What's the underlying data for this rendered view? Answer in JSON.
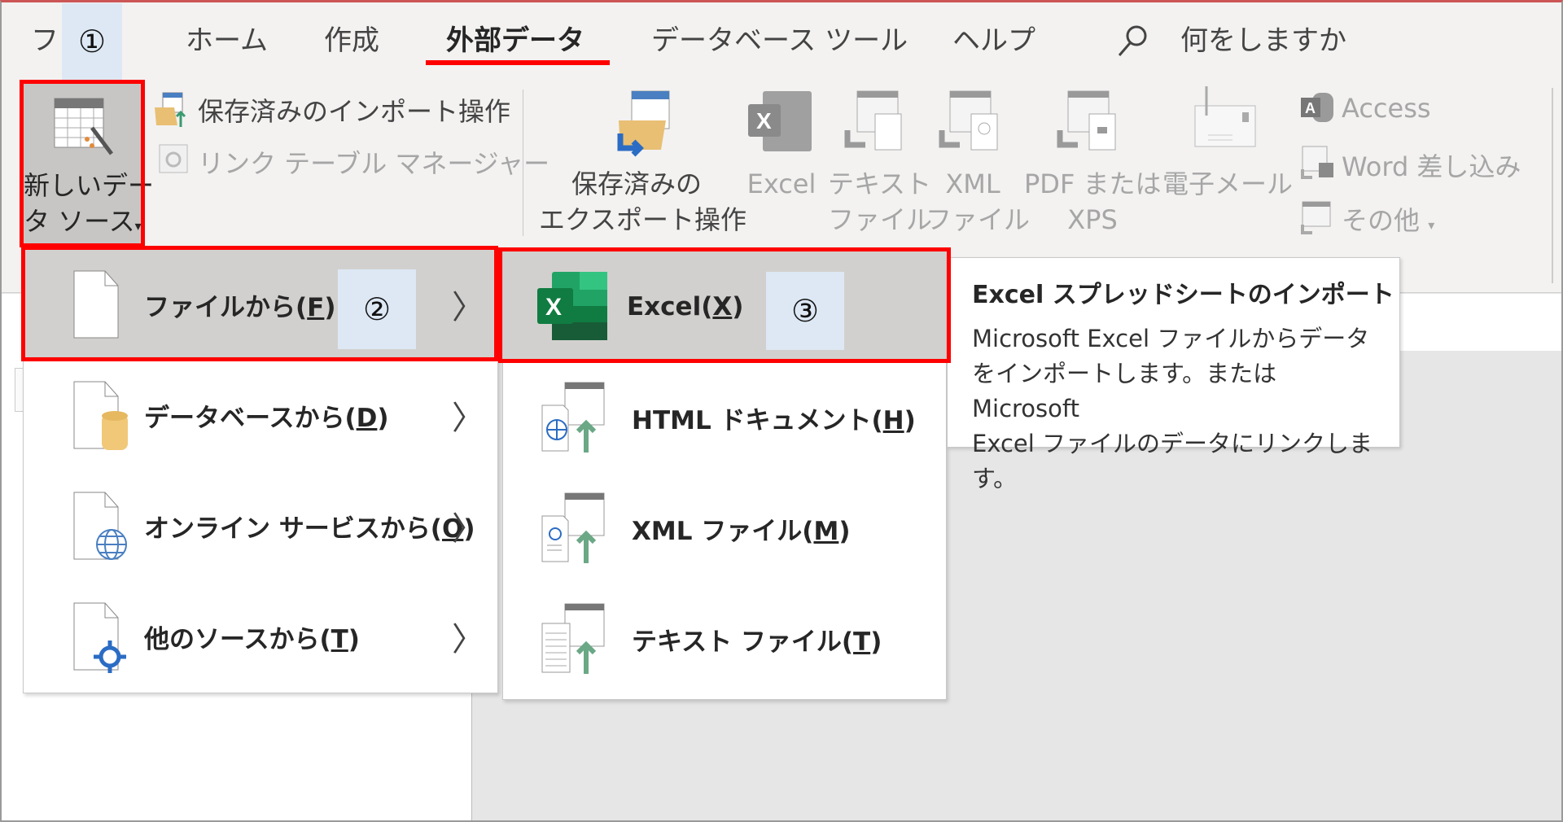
{
  "tabs": [
    {
      "label": "フ",
      "active": false
    },
    {
      "label": "ホーム",
      "active": false
    },
    {
      "label": "作成",
      "active": false
    },
    {
      "label": "外部データ",
      "active": true
    },
    {
      "label": "データベース ツール",
      "active": false
    },
    {
      "label": "ヘルプ",
      "active": false
    }
  ],
  "search": {
    "icon": "search-icon",
    "placeholder": "何をしますか"
  },
  "annotations": {
    "step1": "①",
    "step2": "②",
    "step3": "③",
    "highlight_color": "#ff0000"
  },
  "ribbon": {
    "new_source": {
      "line1": "新しいデー",
      "line2": "タ ソース",
      "caret": "▾"
    },
    "saved_imports": "保存済みのインポート操作",
    "linked_table_manager": "リンク テーブル マネージャー",
    "saved_exports": {
      "line1": "保存済みの",
      "line2": "エクスポート操作"
    },
    "export": [
      {
        "line1": "Excel",
        "line2": ""
      },
      {
        "line1": "テキスト",
        "line2": "ファイル"
      },
      {
        "line1": "XML",
        "line2": "ファイル"
      },
      {
        "line1": "PDF または",
        "line2": "XPS"
      },
      {
        "line1": "電子メール",
        "line2": ""
      }
    ],
    "access": "Access",
    "word_merge": "Word 差し込み",
    "more": "その他",
    "more_caret": "▾"
  },
  "menu1": {
    "items": [
      {
        "label": "ファイルから(",
        "key": "F",
        "end": ")",
        "icon": "file-icon",
        "chevron": "〉"
      },
      {
        "label": "データベースから(",
        "key": "D",
        "end": ")",
        "icon": "database-file-icon",
        "chevron": "〉"
      },
      {
        "label": "オンライン サービスから(",
        "key": "O",
        "end": ")",
        "icon": "online-service-icon",
        "chevron": "〉"
      },
      {
        "label": "他のソースから(",
        "key": "T",
        "end": ")",
        "icon": "other-source-icon",
        "chevron": "〉"
      }
    ]
  },
  "menu2": {
    "items": [
      {
        "label": "Excel(",
        "key": "X",
        "end": ")",
        "icon": "excel-icon"
      },
      {
        "label": "HTML ドキュメント(",
        "key": "H",
        "end": ")",
        "icon": "html-import-icon"
      },
      {
        "label": "XML ファイル(",
        "key": "M",
        "end": ")",
        "icon": "xml-import-icon"
      },
      {
        "label": "テキスト ファイル(",
        "key": "T",
        "end": ")",
        "icon": "text-import-icon"
      }
    ]
  },
  "tooltip": {
    "title": "Excel スプレッドシートのインポート",
    "body_line1": "Microsoft Excel ファイルからデータ",
    "body_line2": "をインポートします。または Microsoft",
    "body_line3": "Excel ファイルのデータにリンクします。"
  }
}
